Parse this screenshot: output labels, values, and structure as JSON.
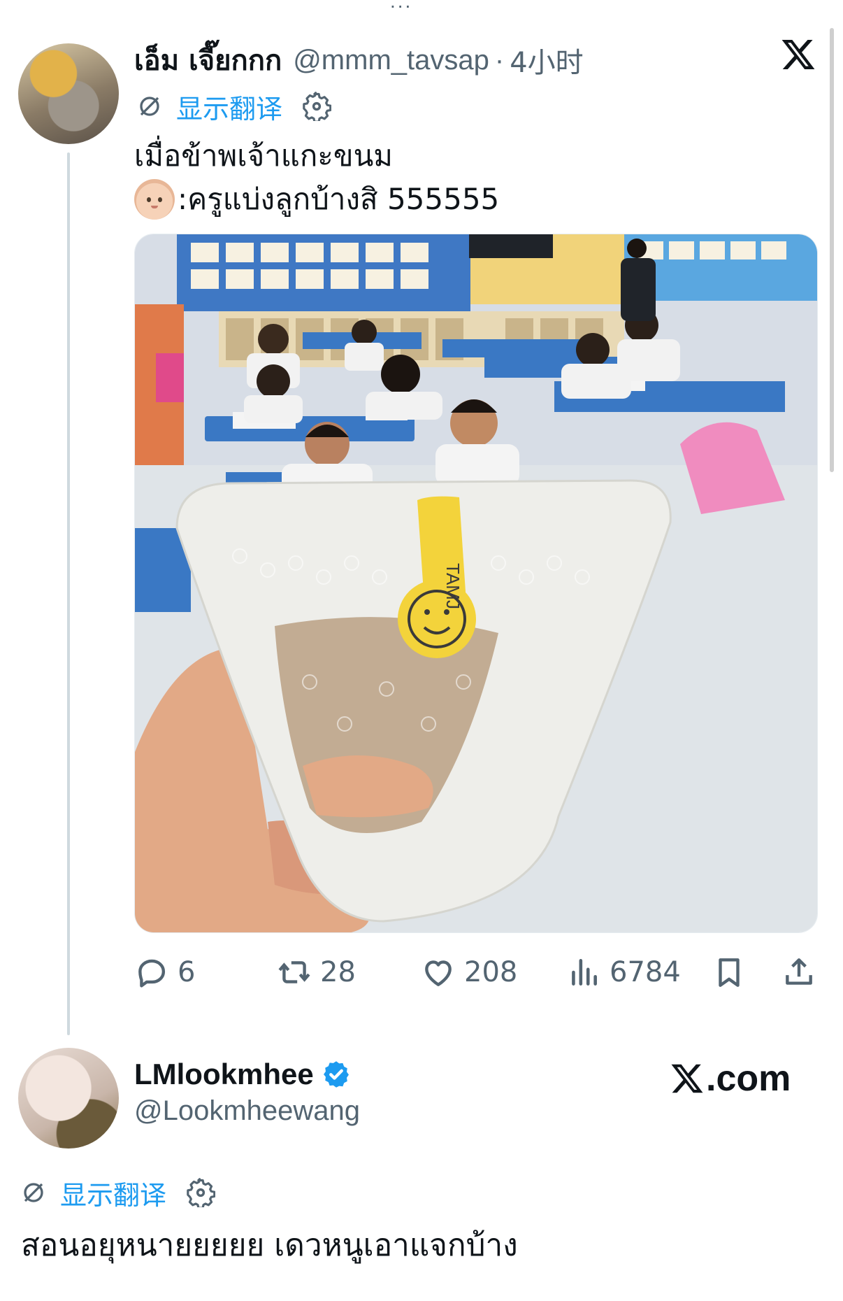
{
  "top_indicator": "...",
  "tweet": {
    "author": {
      "name": "เอ็ม เจี๊ยกกก",
      "handle": "@mmm_tavsap",
      "separator": "·",
      "time": "4小时"
    },
    "translate": {
      "label": "显示翻译"
    },
    "text_line1": "เมื่อข้าพเจ้าแกะขนม",
    "text_line2": ":ครูแบ่งลูกบ้างสิ 555555",
    "photo_tape_text": "TAMJ",
    "actions": {
      "replies": "6",
      "retweets": "28",
      "likes": "208",
      "views": "6784"
    }
  },
  "reply": {
    "author": {
      "name": "LMlookmhee",
      "handle": "@Lookmheewang",
      "verified": true
    },
    "translate": {
      "label": "显示翻译"
    },
    "text": "สอนอยุหนายยยยย เดวหนูเอาแจกบ้าง"
  },
  "watermark": {
    "text": ".com"
  },
  "colors": {
    "accent": "#1d9bf0",
    "text": "#0f1419",
    "muted": "#536471",
    "thread_line": "#cfd9de"
  },
  "icons": [
    "x-logo-icon",
    "translate-icon",
    "gear-icon",
    "reply-icon",
    "retweet-icon",
    "like-icon",
    "views-icon",
    "bookmark-icon",
    "share-icon",
    "verified-badge-icon"
  ]
}
